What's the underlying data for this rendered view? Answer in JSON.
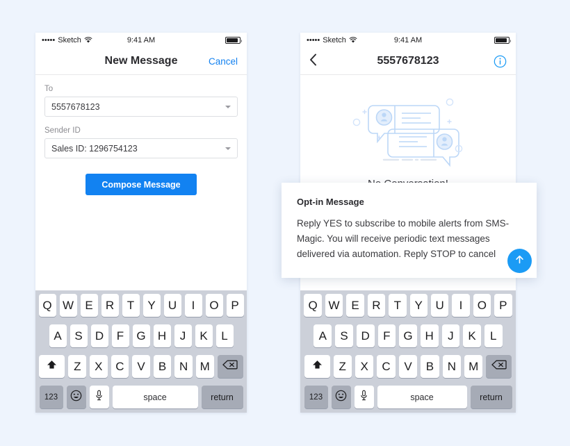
{
  "theme": {
    "page_background": "#eef4fd",
    "accent_blue": "#1282f1",
    "link_blue": "#1482f0",
    "fab_blue": "#1b9bf5",
    "keyboard_bg": "#ccd0d9",
    "key_white": "#ffffff",
    "key_dark": "#a6abb6",
    "illustration_blue": "#bcd7f7"
  },
  "status_bar": {
    "signal_dots": "•••••",
    "carrier": "Sketch",
    "wifi_icon": "wifi-icon",
    "time": "9:41 AM",
    "battery_icon": "battery-icon"
  },
  "phone_left": {
    "nav": {
      "title": "New Message",
      "cancel_label": "Cancel"
    },
    "form": {
      "to_label": "To",
      "to_value": "5557678123",
      "sender_label": "Sender ID",
      "sender_value": "Sales ID: 1296754123",
      "caret_icon": "chevron-down-icon",
      "compose_button": "Compose Message"
    }
  },
  "phone_right": {
    "nav": {
      "back_icon": "chevron-left-icon",
      "title": "5557678123",
      "info_icon": "info-circle-icon"
    },
    "empty_state": {
      "illustration": "chat-bubbles-illustration",
      "caption": "No Conversation!"
    }
  },
  "optin_card": {
    "title": "Opt-in Message",
    "body": "Reply YES to subscribe to mobile alerts from SMS-Magic. You will receive periodic text messages delivered via automation. Reply STOP to cancel",
    "send_icon": "arrow-up-icon"
  },
  "keyboard": {
    "row1": [
      "Q",
      "W",
      "E",
      "R",
      "T",
      "Y",
      "U",
      "I",
      "O",
      "P"
    ],
    "row2": [
      "A",
      "S",
      "D",
      "F",
      "G",
      "H",
      "J",
      "K",
      "L"
    ],
    "row3": [
      "Z",
      "X",
      "C",
      "V",
      "B",
      "N",
      "M"
    ],
    "shift_icon": "shift-up-icon",
    "delete_icon": "backspace-icon",
    "numbers_key": "123",
    "emoji_icon": "smiley-icon",
    "mic_icon": "microphone-icon",
    "space_key": "space",
    "return_key": "return"
  }
}
